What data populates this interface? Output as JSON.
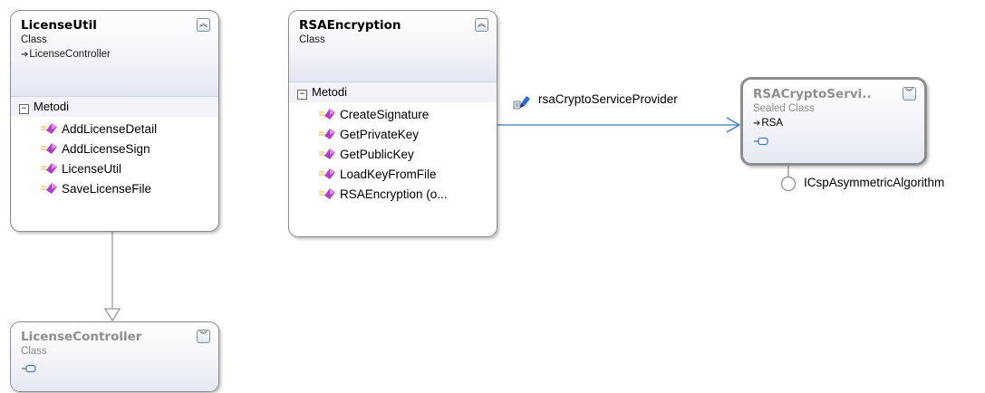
{
  "classes": {
    "license_util": {
      "name": "LicenseUtil",
      "stereotype": "Class",
      "base": "LicenseController",
      "compartment": "Metodi",
      "methods": [
        "AddLicenseDetail",
        "AddLicenseSign",
        "LicenseUtil",
        "SaveLicenseFile"
      ],
      "collapsed": false
    },
    "rsa_encryption": {
      "name": "RSAEncryption",
      "stereotype": "Class",
      "compartment": "Metodi",
      "methods": [
        "CreateSignature",
        "GetPrivateKey",
        "GetPublicKey",
        "LoadKeyFromFile",
        "RSAEncryption (o..."
      ],
      "collapsed": false
    },
    "rsa_crypto": {
      "name": "RSACryptoServi..",
      "stereotype": "Sealed Class",
      "base": "RSA",
      "collapsed": true
    },
    "license_controller": {
      "name": "LicenseController",
      "stereotype": "Class",
      "collapsed": true
    }
  },
  "association": {
    "label": "rsaCryptoServiceProvider"
  },
  "interface": {
    "label": "ICspAsymmetricAlgorithm"
  },
  "icons": {
    "collapse": "double-chevron-up-icon",
    "expand": "double-chevron-down-icon",
    "method": "method-icon",
    "inheritance": "inheritance-arrow-icon",
    "association": "association-icon",
    "lollipop": "interface-lollipop-icon"
  },
  "colors": {
    "connector_blue": "#3c78c8",
    "inheritance_grey": "#9a9a9a",
    "method_purple": "#b040c8",
    "header_gradient_end": "#e4e7f2"
  }
}
